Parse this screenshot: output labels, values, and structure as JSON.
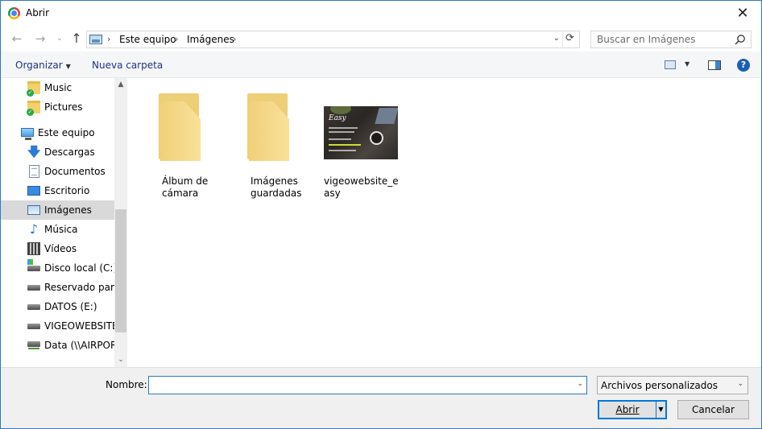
{
  "window": {
    "title": "Abrir",
    "close_glyph": "✕"
  },
  "nav": {
    "back_glyph": "←",
    "forward_glyph": "→",
    "recent_glyph": "⌄",
    "up_glyph": "↑",
    "breadcrumbs": [
      "Este equipo",
      "Imágenes"
    ],
    "crumb_sep": "›",
    "refresh_glyph": "⟳",
    "dropdown_glyph": "⌄"
  },
  "search": {
    "placeholder": "Buscar en Imágenes"
  },
  "toolbar": {
    "organize_label": "Organizar",
    "new_folder_label": "Nueva carpeta",
    "caret": "▼",
    "help_glyph": "?"
  },
  "sidebar": {
    "items": [
      {
        "label": "Music",
        "icon": "folder-check-icon"
      },
      {
        "label": "Pictures",
        "icon": "folder-check-icon"
      },
      {
        "label": "Este equipo",
        "icon": "computer-icon"
      },
      {
        "label": "Descargas",
        "icon": "download-icon"
      },
      {
        "label": "Documentos",
        "icon": "document-icon"
      },
      {
        "label": "Escritorio",
        "icon": "desktop-icon"
      },
      {
        "label": "Imágenes",
        "icon": "images-icon",
        "selected": true
      },
      {
        "label": "Música",
        "icon": "music-icon"
      },
      {
        "label": "Vídeos",
        "icon": "video-icon"
      },
      {
        "label": "Disco local (C:)",
        "icon": "system-drive-icon"
      },
      {
        "label": "Reservado para e",
        "icon": "drive-icon"
      },
      {
        "label": "DATOS (E:)",
        "icon": "drive-icon"
      },
      {
        "label": "VIGEOWEBSITE (",
        "icon": "drive-icon"
      },
      {
        "label": "Data (\\\\AIRPORT",
        "icon": "network-drive-icon"
      }
    ],
    "scroll_up": "▲",
    "scroll_down": "⌄"
  },
  "files": [
    {
      "name": "Álbum de cámara",
      "type": "folder"
    },
    {
      "name": "Imágenes guardadas",
      "type": "folder"
    },
    {
      "name": "vigeowebsite_easy",
      "type": "image"
    }
  ],
  "thumbnail_text": "Easy",
  "bottom": {
    "name_label": "Nombre:",
    "name_value": "",
    "filter_value": "Archivos personalizados",
    "open_label": "Abrir",
    "cancel_label": "Cancelar",
    "dropdown_glyph": "⌄",
    "split_glyph": "▼"
  },
  "colors": {
    "accent": "#0078d7",
    "link_text": "#1e3287",
    "selected_bg": "#d9d9d9",
    "folder": "#f7dc8b"
  }
}
